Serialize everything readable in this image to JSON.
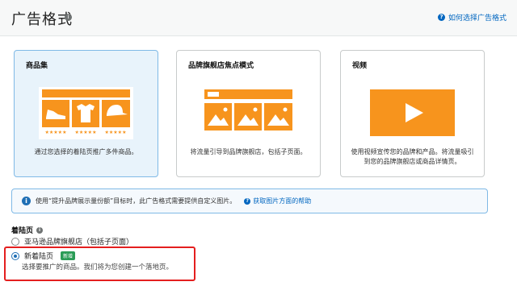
{
  "header": {
    "title": "广告格式",
    "help_link": "如何选择广告格式"
  },
  "cards": [
    {
      "title": "商品集",
      "description": "通过您选择的着陆页推广多件商品。"
    },
    {
      "title": "品牌旗舰店焦点模式",
      "description": "将流量引导到品牌旗舰店，包括子页面。"
    },
    {
      "title": "视频",
      "description": "使用视频宣传您的品牌和产品。将流量吸引到您的品牌旗舰店或商品详情页。"
    }
  ],
  "notice": {
    "text": "使用“提升品牌展示量份额”目标时，此广告格式需要提供自定义图片。",
    "help_link": "获取图片方面的帮助"
  },
  "landing_page": {
    "label": "着陆页",
    "options": [
      {
        "label": "亚马逊品牌旗舰店（包括子页面）",
        "checked": false
      },
      {
        "label": "新着陆页",
        "checked": true,
        "badge": "新增"
      }
    ],
    "new_desc": "选择要推广的商品。我们将为您创建一个落地页。"
  },
  "colors": {
    "accent": "#0066c0",
    "orange": "#f7941d",
    "selected_bg": "#e8f3fb",
    "highlight": "#e41f1f"
  }
}
